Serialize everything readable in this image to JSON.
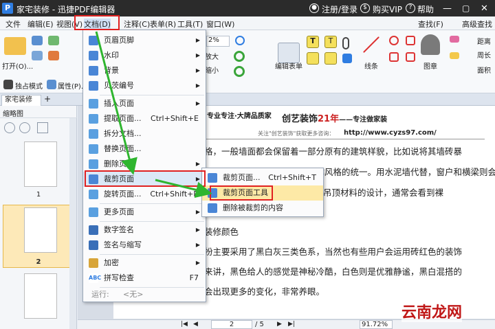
{
  "window": {
    "title": "家宅装修 - 迅捷PDF编辑器",
    "logo": "P",
    "register": "注册/登录",
    "buy": "购买VIP",
    "help": "帮助"
  },
  "menubar": [
    "文件",
    "编辑(E)",
    "视图(V)",
    "文档(D)",
    "注释(C)",
    "表单(R)",
    "工具(T)",
    "窗口(W)"
  ],
  "ribbon": {
    "open": "打开(O)...",
    "exclusive_mode": "独占模式",
    "properties": "属性(P)...",
    "zoom_value": "2%",
    "zoom_in": "放大",
    "zoom_out": "缩小",
    "edit_form": "编辑表单",
    "lines": "线条",
    "stamp": "图章",
    "distance": "距离",
    "perimeter": "周长",
    "area": "面积",
    "find": "查找(F)",
    "adv_find": "高级查找"
  },
  "tab": {
    "doc_name": "家宅装修",
    "add": "+"
  },
  "thumbs": {
    "header": "缩略图",
    "pages": [
      "1",
      "2"
    ]
  },
  "doc_menu": {
    "items": [
      "页眉页脚",
      "水印",
      "背景",
      "贝茨编号",
      "插入页面",
      "提取页面...",
      "拆分文档...",
      "替换页面...",
      "删除页面",
      "裁剪页面",
      "旋转页面...",
      "更多页面",
      "数字签名",
      "签名与缩写",
      "加密",
      "拼写检查"
    ],
    "shortcuts": {
      "extract": "Ctrl+Shift+E",
      "rotate": "Ctrl+Shift+R",
      "spell": "F7"
    },
    "run_label": "运行:",
    "run_value": "<无>"
  },
  "crop_submenu": {
    "items": [
      "裁剪页面...",
      "裁剪页面工具",
      "删除被裁剪的内容"
    ],
    "shortcut": "Ctrl+Shift+T"
  },
  "page_content": {
    "header_title": "创艺装饰",
    "header_red": "21年",
    "header_suffix": "——专注做家装",
    "attention": "关注\"创艺装饰\"获取更多咨询：",
    "url": "http://www.cyzs97.com/",
    "slogan": "专业专注·大牌品质家",
    "lines": [
      "格，一般墙面都会保留着一部分原有的建筑样貌，比如说将其墙砖暴",
      "尺寸采用红砖来设计，达到整体风格的统一。用水泥墙代替，窗户和横梁则会做成",
      "吊顶材料的设计，通常会看到裸",
      "装修颜色",
      "扮主要采用了黑白灰三类色系，当然也有些用户会运用砖红色的装饰",
      "来讲，黑色给人的感觉是神秘冷酷，白色则是优雅静谧，黑白混搭的",
      "会出现更多的变化，非常养眼。"
    ]
  },
  "status": {
    "page_input": "2",
    "page_total": "/ 5",
    "zoom": "91.72%"
  },
  "watermark": "云南龙网"
}
